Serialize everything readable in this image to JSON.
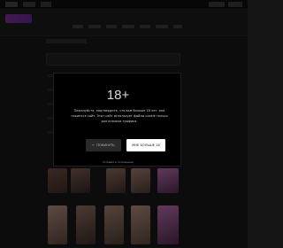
{
  "modal": {
    "title": "18+",
    "message": "Пожалуйста, подтвердите, что вам больше 18 лет, или покиньте сайт. Этот сайт использует файлы cookie только для анализа трафика.",
    "leave_label": "ПОКИНУТЬ",
    "enter_label": "МНЕ БОЛЬШЕ 18",
    "terms_label": "Условия и положения"
  },
  "colors": {
    "background": "#161616",
    "modal_background": "#000000",
    "enter_button": "#ffffff",
    "leave_button": "#2a2a2a",
    "logo_accent": "#7a2f8f"
  },
  "icons": {
    "leave_icon": "arrow-left-icon"
  }
}
